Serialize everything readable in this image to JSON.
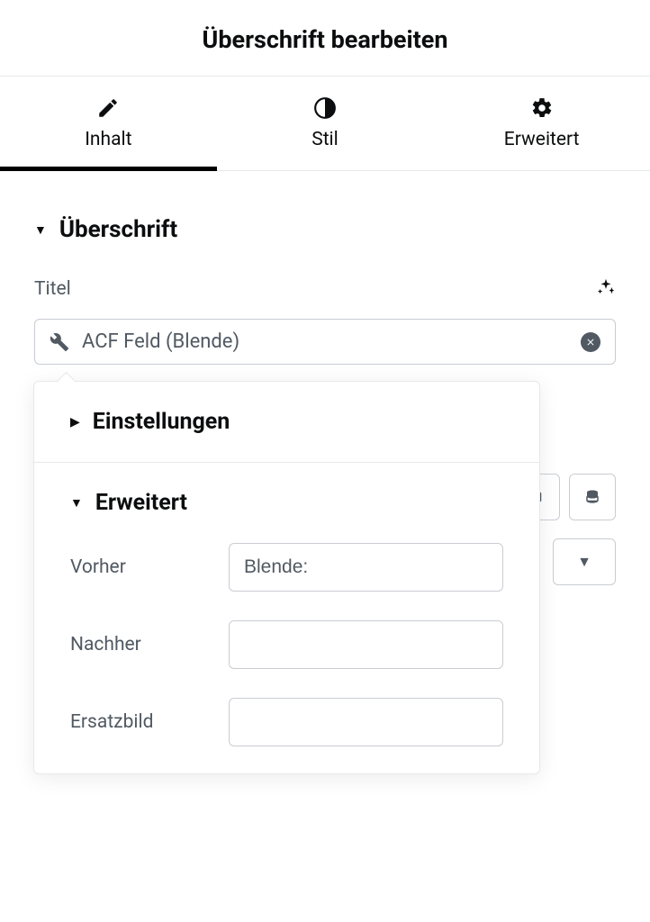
{
  "header": {
    "title": "Überschrift bearbeiten"
  },
  "tabs": {
    "content": "Inhalt",
    "style": "Stil",
    "advanced": "Erweitert"
  },
  "section": {
    "title": "Überschrift"
  },
  "titleControl": {
    "label": "Titel",
    "dynamicValue": "ACF Feld (Blende)"
  },
  "popover": {
    "settings": {
      "title": "Einstellungen"
    },
    "advanced": {
      "title": "Erweitert",
      "fields": {
        "before": {
          "label": "Vorher",
          "value": "Blende:"
        },
        "after": {
          "label": "Nachher",
          "value": ""
        },
        "fallback": {
          "label": "Ersatzbild",
          "value": ""
        }
      }
    }
  }
}
